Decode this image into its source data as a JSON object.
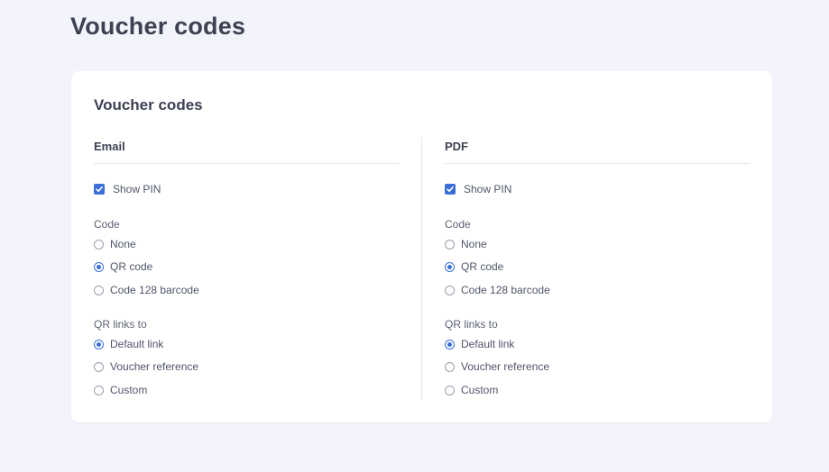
{
  "page": {
    "title": "Voucher codes"
  },
  "card": {
    "title": "Voucher codes"
  },
  "columns": [
    {
      "title": "Email",
      "show_pin": {
        "label": "Show PIN",
        "checked": true
      },
      "code": {
        "label": "Code",
        "options": [
          "None",
          "QR code",
          "Code 128 barcode"
        ],
        "selected": "QR code"
      },
      "qr_links": {
        "label": "QR links to",
        "options": [
          "Default link",
          "Voucher reference",
          "Custom"
        ],
        "selected": "Default link"
      }
    },
    {
      "title": "PDF",
      "show_pin": {
        "label": "Show PIN",
        "checked": true
      },
      "code": {
        "label": "Code",
        "options": [
          "None",
          "QR code",
          "Code 128 barcode"
        ],
        "selected": "QR code"
      },
      "qr_links": {
        "label": "QR links to",
        "options": [
          "Default link",
          "Voucher reference",
          "Custom"
        ],
        "selected": "Default link"
      }
    }
  ],
  "colors": {
    "accent": "#3b6fd6",
    "background": "#f3f4fb",
    "card": "#ffffff"
  }
}
